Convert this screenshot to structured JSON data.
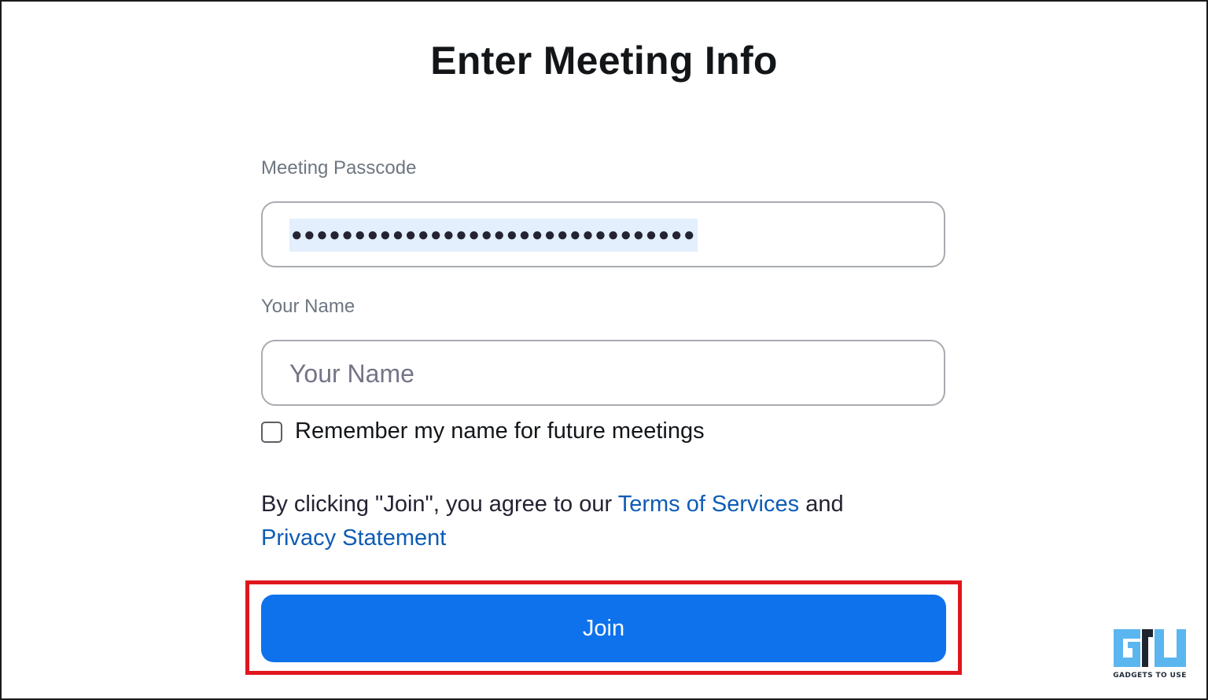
{
  "page": {
    "title": "Enter Meeting Info"
  },
  "passcode": {
    "label": "Meeting Passcode",
    "masked_value": "●●●●●●●●●●●●●●●●●●●●●●●●●●●●●●●●"
  },
  "name": {
    "label": "Your Name",
    "placeholder": "Your Name"
  },
  "remember": {
    "label": "Remember my name for future meetings",
    "checked": false
  },
  "agreement": {
    "prefix": "By clicking \"Join\", you agree to our ",
    "terms_link": "Terms of Services",
    "connector": " and",
    "privacy_link": "Privacy Statement"
  },
  "join": {
    "label": "Join"
  },
  "watermark": {
    "icon": "gadgets-to-use-logo-icon",
    "caption": "GADGETS TO USE"
  },
  "colors": {
    "primary": "#0e72ed",
    "link": "#0e5cb5",
    "highlight": "#e0161e",
    "selection": "#e3effc"
  }
}
